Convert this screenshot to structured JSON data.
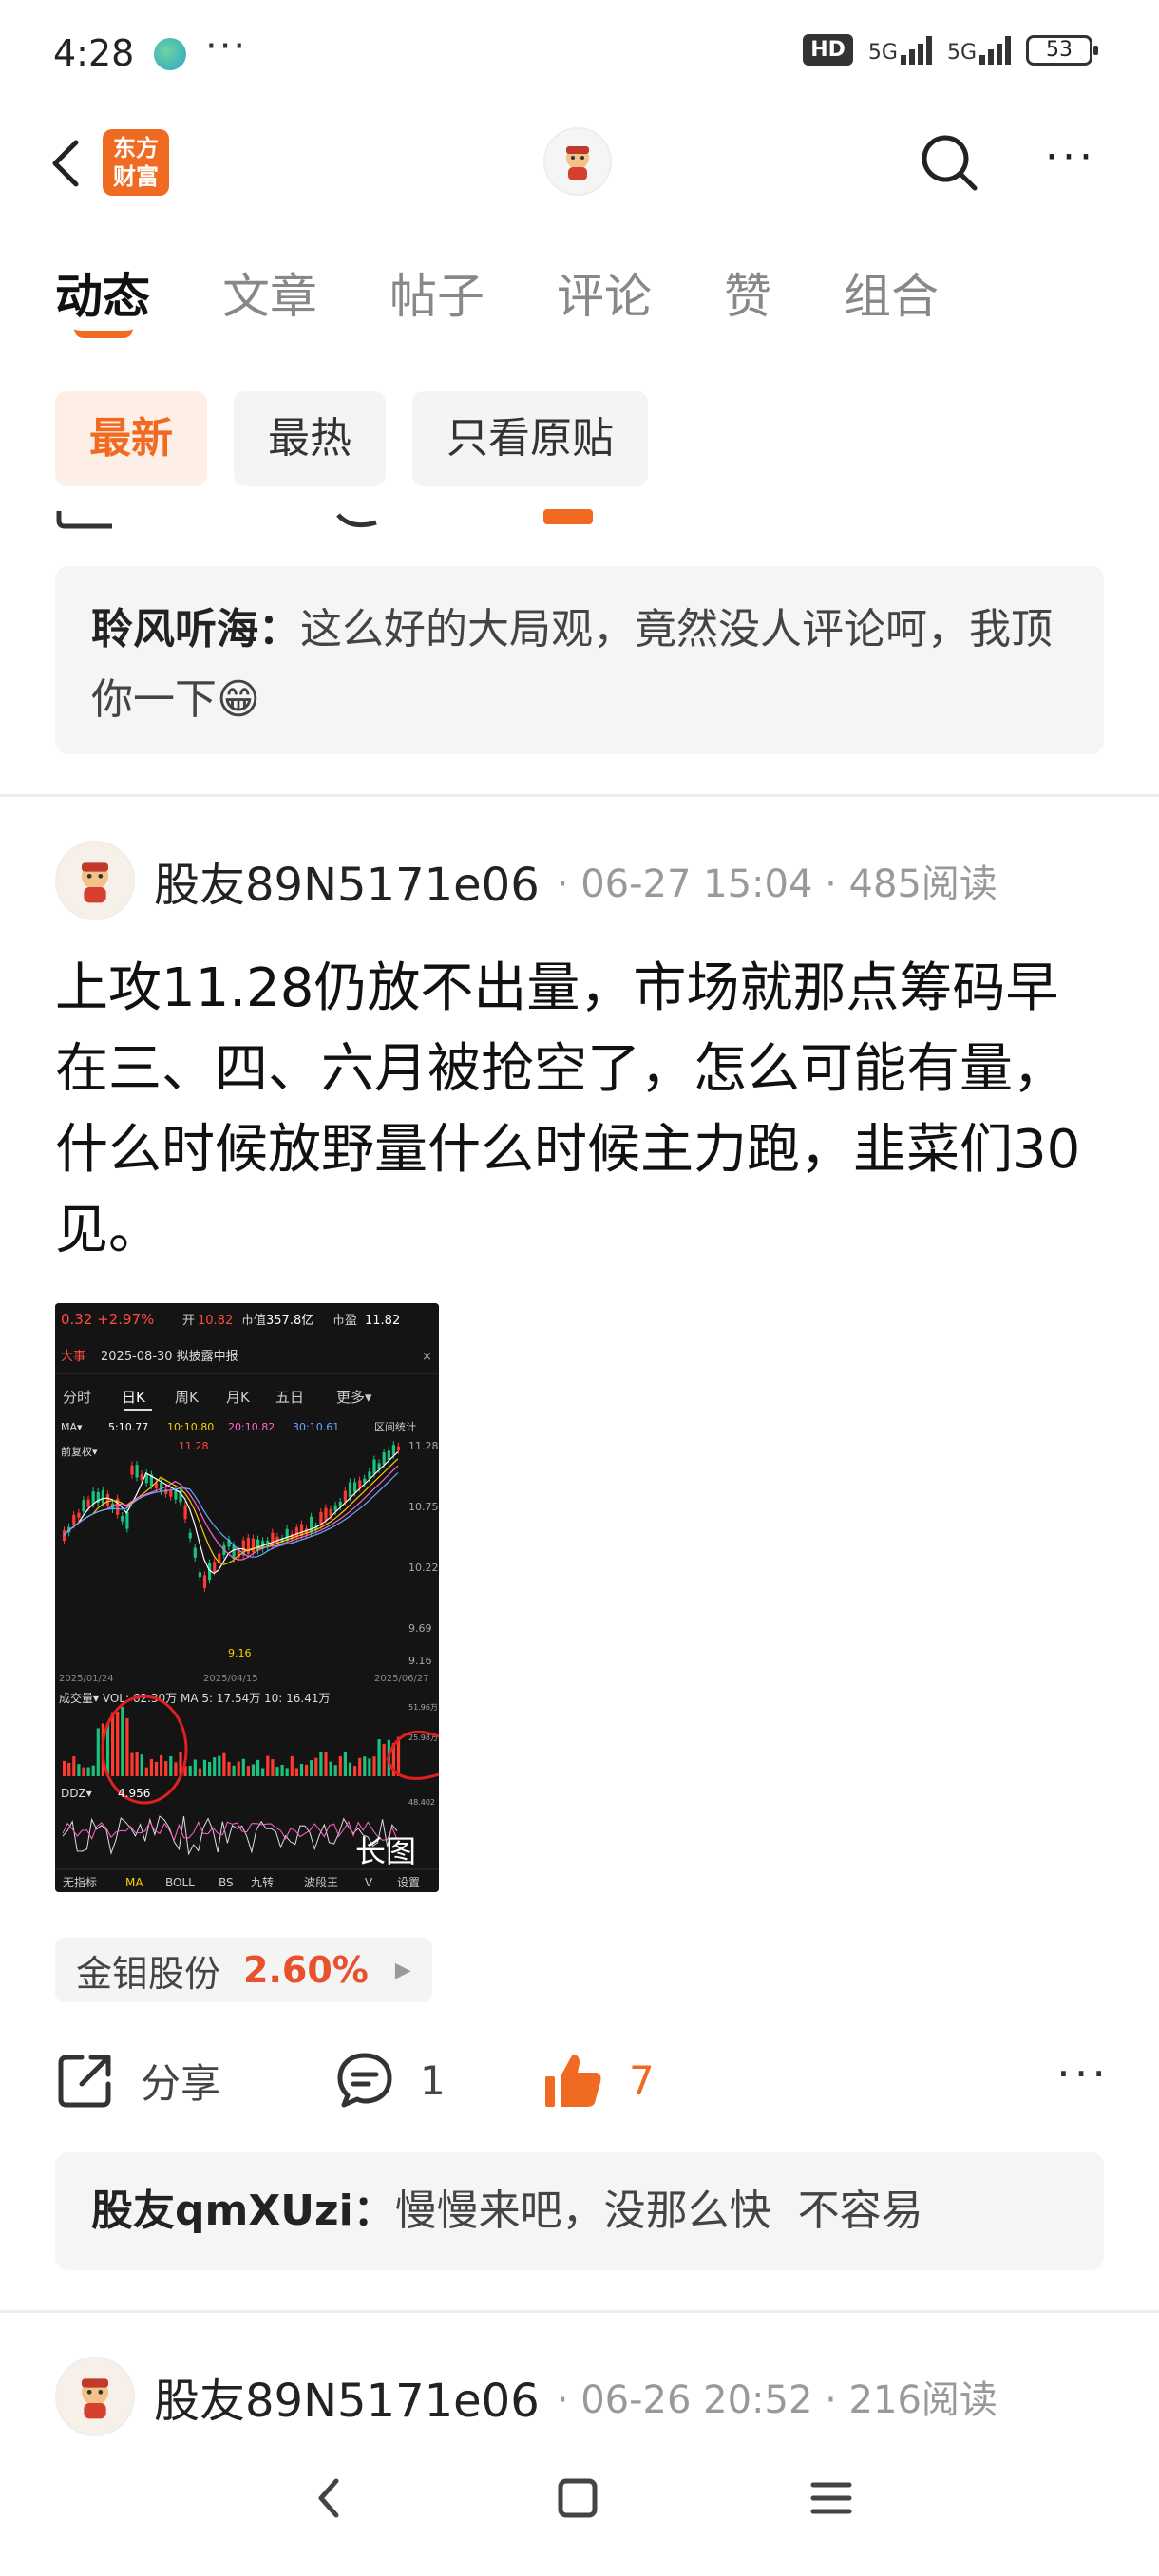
{
  "status_bar": {
    "time": "4:28",
    "dots": "···",
    "hd": "HD",
    "net1": "5G",
    "net2": "5G",
    "battery": "53"
  },
  "nav": {
    "logo_line1": "东方",
    "logo_line2": "财富"
  },
  "tabs": [
    "动态",
    "文章",
    "帖子",
    "评论",
    "赞",
    "组合"
  ],
  "filters": [
    "最新",
    "最热",
    "只看原贴"
  ],
  "reply_top": {
    "name": "聆风听海：",
    "text": "这么好的大局观，竟然没人评论呵，我顶你一下😁"
  },
  "post1": {
    "author": "股友89N5171e06",
    "meta": "· 06-27 15:04 · 485阅读",
    "text": "上攻11.28仍放不出量，市场就那点筹码早在三、四、六月被抢空了，怎么可能有量，什么时候放野量什么时候主力跑，韭菜们30见。",
    "image_label": "长图",
    "stock_name": "金钼股份",
    "stock_change": "2.60%",
    "share_label": "分享",
    "comment_count": "1",
    "like_count": "7",
    "reply": {
      "name": "股友qmXUzi：",
      "text": "慢慢来吧，没那么快  不容易"
    }
  },
  "post2": {
    "author": "股友89N5171e06",
    "meta": "· 06-26 20:52 · 216阅读"
  },
  "chart_thumb": {
    "price_line": "0.32 +2.97%",
    "open_label": "开",
    "open": "10.82",
    "mkt_cap_label": "市值",
    "mkt_cap": "357.8亿",
    "pe_label": "市盈",
    "pe": "11.82",
    "badge": "大事",
    "event": "2025-08-30 拟披露中报",
    "periods": [
      "分时",
      "日K",
      "周K",
      "月K",
      "五日",
      "更多▾"
    ],
    "ma_line": [
      "MA▾",
      "5:10.77",
      "10:10.80",
      "20:10.82",
      "30:10.61",
      "区间统计"
    ],
    "fq": "前复权▾",
    "high": "11.28",
    "low": "9.16",
    "ylabels": [
      "11.28",
      "10.75",
      "10.22",
      "9.69",
      "9.16"
    ],
    "date_start": "2025/01/24",
    "date_mid": "2025/04/15",
    "date_end": "2025/06/27",
    "vol_line": "成交量▾  VOL: 62.30万   MA 5: 17.54万   10: 16.41万",
    "vol_right": "51.96万",
    "vol_right2": "25.98万",
    "ddz": "DDZ▾",
    "ddz_val": "4.956",
    "ddz_right": "48.402",
    "bottom_tabs": [
      "无指标",
      "MA",
      "BOLL",
      "BS",
      "九转",
      "波段王",
      "V",
      "设置"
    ]
  }
}
